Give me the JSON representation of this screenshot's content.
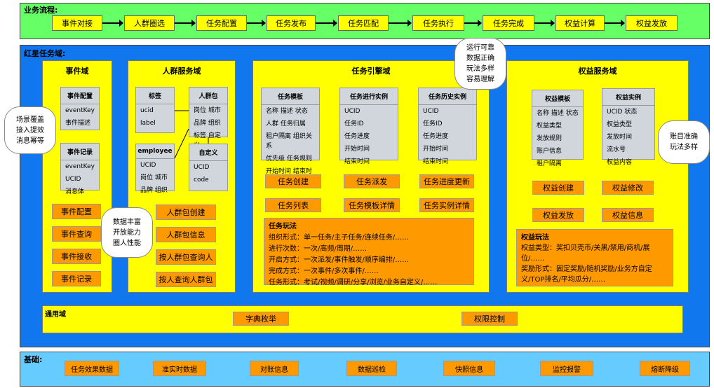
{
  "flow": {
    "title": "业务流程:",
    "steps": [
      "事件对接",
      "人群圈选",
      "任务配置",
      "任务发布",
      "任务匹配",
      "任务执行",
      "任务完成",
      "权益计算",
      "权益发放"
    ]
  },
  "main": {
    "title": "红星任务域:",
    "event_domain": {
      "title": "事件域",
      "config_box": {
        "header": "事件配置",
        "lines": [
          "eventKey",
          "事件描述"
        ]
      },
      "record_box": {
        "header": "事件记录",
        "lines": [
          "eventKey",
          "UCID",
          "消息体"
        ]
      },
      "buttons": [
        "事件配置",
        "事件查询",
        "事件接收",
        "事件记录"
      ]
    },
    "crowd_domain": {
      "title": "人群服务域",
      "tag_box": {
        "header": "标签",
        "lines": [
          "ucid",
          "label"
        ]
      },
      "pack_box": {
        "header": "人群包",
        "lines": [
          "岗位 城市",
          "品牌 组织",
          "标签 自定义"
        ]
      },
      "employee_box": {
        "header": "employee",
        "lines": [
          "UCID",
          "岗位 城市",
          "品牌 组织"
        ]
      },
      "custom_box": {
        "header": "自定义",
        "lines": [
          "UCID",
          "code"
        ]
      },
      "buttons": [
        "人群包创建",
        "人群包信息",
        "按人群包查询人",
        "按人查询人群包"
      ]
    },
    "task_domain": {
      "title": "任务引擎域",
      "template_box": {
        "header": "任务模板",
        "lines": [
          "名称 描述 状态",
          "人群 任务归属",
          "租户隔离 组织关系",
          "优先级 任务规则",
          "开始时间 结束时间"
        ]
      },
      "instance_box": {
        "header": "任务进行实例",
        "lines": [
          "UCID",
          "任务ID",
          "任务进度",
          "开始时间",
          "结束时间"
        ]
      },
      "history_box": {
        "header": "任务历史实例",
        "lines": [
          "UCID",
          "任务ID",
          "任务进度",
          "开始时间",
          "结束时间"
        ]
      },
      "buttons": [
        "任务创建",
        "任务派发",
        "任务进度更新",
        "任务列表",
        "任务模板详情",
        "任务实例详情"
      ],
      "play": {
        "title": "任务玩法",
        "lines": [
          "组织形式：单一任务/主子任务/连续任务/……",
          "进行次数：一次/高频/周期/……",
          "开启方式：一次派发/事件触发/顺序编排/……",
          "完成方式：一次事件/多次事件/……",
          "任务形式：考试/视频/调研/分享/浏览/业务自定义/……"
        ]
      }
    },
    "rights_domain": {
      "title": "权益服务域",
      "template_box": {
        "header": "权益模板",
        "lines": [
          "名称 描述 状态",
          "权益类型",
          "发放规则",
          "账户信息",
          "租户隔离"
        ]
      },
      "instance_box": {
        "header": "权益实例",
        "lines": [
          "UCID 状态",
          "权益类型",
          "发放时间",
          "流水号",
          "权益内容"
        ]
      },
      "buttons": [
        "权益创建",
        "权益修改",
        "权益发放",
        "权益信息"
      ],
      "play": {
        "title": "权益玩法",
        "lines": [
          "权益类型：奖扣贝壳币/关黑/禁用/商机/展",
          "位/……",
          "奖励形式：固定奖励/随机奖励/业务方自定",
          "义/TOP排名/平均瓜分/……"
        ]
      }
    },
    "common_domain": {
      "title": "通用域",
      "buttons": [
        "字典枚举",
        "权限控制"
      ]
    },
    "clouds": {
      "left": [
        "场景覆盖",
        "接入提效",
        "消息幂等"
      ],
      "crowd": [
        "数据丰富",
        "开放能力",
        "圈人性能"
      ],
      "top": [
        "运行可靠",
        "数据正确",
        "玩法多样",
        "容易理解"
      ],
      "right": [
        "账目准确",
        "玩法多样"
      ]
    }
  },
  "base": {
    "title": "基础:",
    "buttons": [
      "任务效果数据",
      "准实时数据",
      "对账信息",
      "数据巡检",
      "快照信息",
      "监控报警",
      "熔断降级"
    ]
  }
}
